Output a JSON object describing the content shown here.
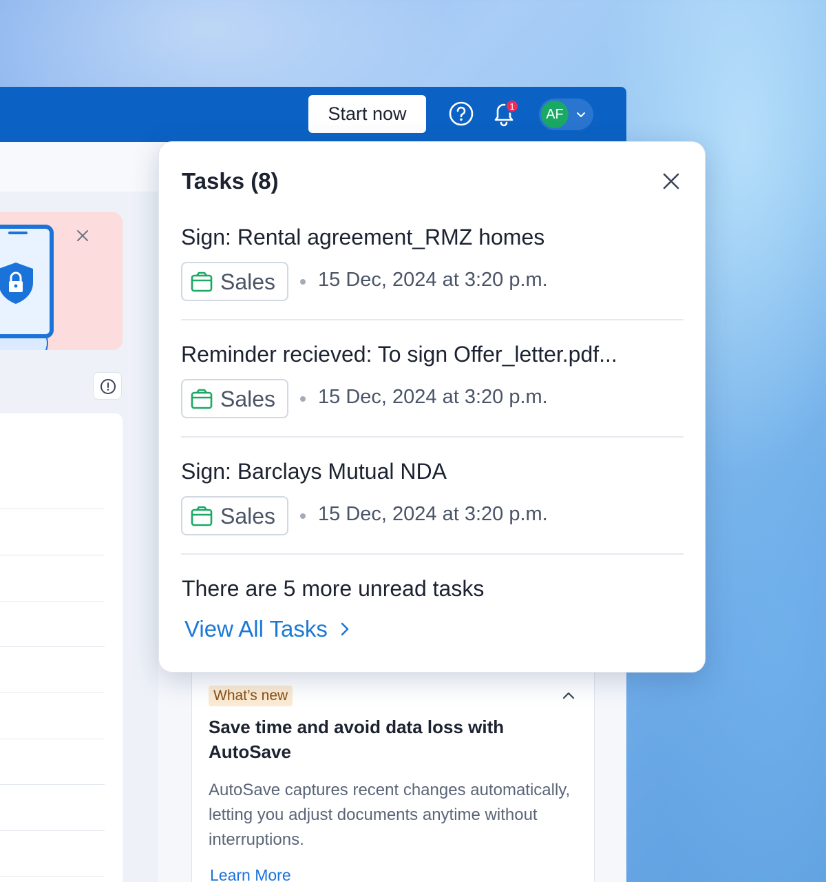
{
  "header": {
    "start_label": "Start now",
    "notification_count": "1",
    "avatar_initials": "AF"
  },
  "tasks_panel": {
    "title": "Tasks (8)",
    "items": [
      {
        "title": "Sign: Rental agreement_RMZ homes",
        "tag": "Sales",
        "time": "15 Dec, 2024 at 3:20 p.m."
      },
      {
        "title": "Reminder recieved: To sign Offer_letter.pdf...",
        "tag": "Sales",
        "time": "15 Dec, 2024 at 3:20 p.m."
      },
      {
        "title": "Sign: Barclays Mutual NDA",
        "tag": "Sales",
        "time": "15 Dec, 2024 at 3:20 p.m."
      }
    ],
    "more_text": "There are 5 more unread tasks",
    "view_all_label": "View All Tasks"
  },
  "whats_new": {
    "tag": "What’s new",
    "title": "Save time and avoid data loss with AutoSave",
    "body": "AutoSave captures recent changes automatically, letting you adjust documents anytime without interruptions.",
    "link": "Learn More"
  },
  "colors": {
    "topbar": "#0b62c4",
    "accent": "#1a78d6",
    "tag_green": "#1aa865",
    "badge": "#ee2b5a"
  },
  "icons": [
    "help-icon",
    "bell-icon",
    "chevron-down-icon",
    "close-icon",
    "shield-lock-icon",
    "info-icon",
    "briefcase-icon",
    "chevron-right-icon",
    "chevron-up-icon"
  ]
}
